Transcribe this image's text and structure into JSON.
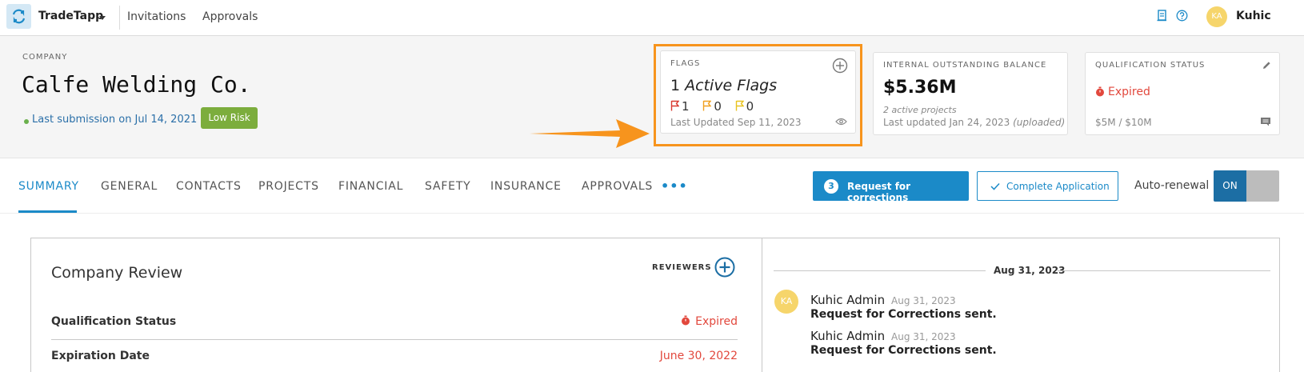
{
  "topbar": {
    "app_name": "TradeTapp",
    "nav": [
      "Invitations",
      "Approvals"
    ],
    "user_initials": "KA",
    "user_name": "Kuhic"
  },
  "company": {
    "label": "COMPANY",
    "name": "Calfe Welding Co.",
    "last_submission": "Last submission on Jul 14, 2021",
    "risk": "Low Risk"
  },
  "flags_card": {
    "label": "FLAGS",
    "active_count": "1",
    "active_text": "Active Flags",
    "red_count": "1",
    "orange_count": "0",
    "yellow_count": "0",
    "last_updated": "Last Updated Sep 11, 2023"
  },
  "balance_card": {
    "label": "INTERNAL OUTSTANDING BALANCE",
    "amount": "$5.36M",
    "projects": "2 active projects",
    "last_updated": "Last updated Jan 24, 2023",
    "uploaded": "(uploaded)"
  },
  "qualification_card": {
    "label": "QUALIFICATION STATUS",
    "status": "Expired",
    "limits": "$5M / $10M"
  },
  "tabs": [
    "SUMMARY",
    "GENERAL",
    "CONTACTS",
    "PROJECTS",
    "FINANCIAL",
    "SAFETY",
    "INSURANCE",
    "APPROVALS"
  ],
  "more_tabs": "•••",
  "actions": {
    "corrections_count": "3",
    "corrections_label": "Request for corrections",
    "complete_label": "Complete Application",
    "auto_renewal_label": "Auto-renewal",
    "toggle_on": "ON"
  },
  "review": {
    "title": "Company Review",
    "reviewers_label": "REVIEWERS",
    "rows": [
      {
        "label": "Qualification Status",
        "value": "Expired"
      },
      {
        "label": "Expiration Date",
        "value": "June 30, 2022"
      }
    ]
  },
  "activity": {
    "date_header": "Aug 31, 2023",
    "entries": [
      {
        "initials": "KA",
        "name": "Kuhic Admin",
        "date": "Aug 31, 2023",
        "message": "Request for Corrections sent."
      },
      {
        "name": "Kuhic Admin",
        "date": "Aug 31, 2023",
        "message": "Request for Corrections sent."
      }
    ]
  },
  "colors": {
    "accent": "#1b8ac8",
    "risk_low": "#7cad3d",
    "expired": "#e2483d",
    "highlight": "#f7941d"
  }
}
